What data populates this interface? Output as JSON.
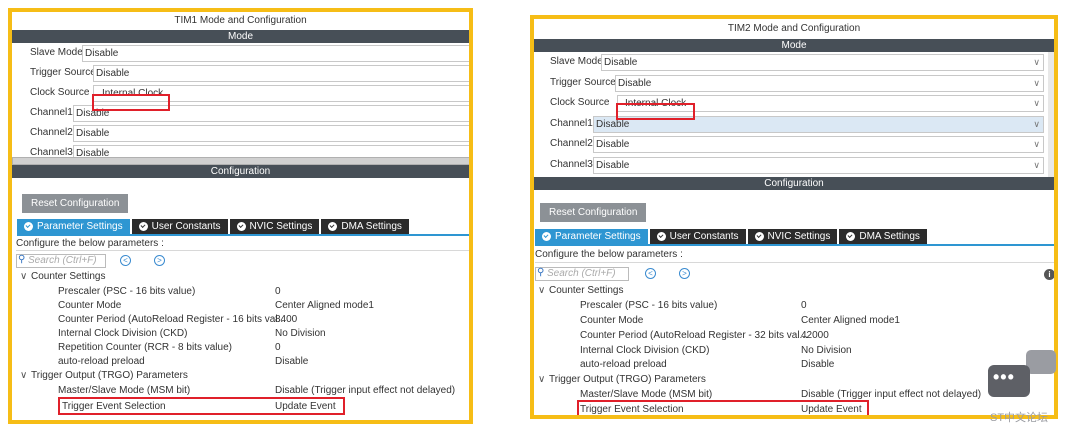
{
  "panels": [
    {
      "title": "TIM1 Mode and Configuration",
      "mode_header": "Mode",
      "mode_rows": [
        {
          "label": "Slave Mode",
          "value": "Disable"
        },
        {
          "label": "Trigger Source",
          "value": "Disable"
        },
        {
          "label": "Clock Source",
          "value": "Internal Clock"
        },
        {
          "label": "Channel1",
          "value": "Disable"
        },
        {
          "label": "Channel2",
          "value": "Disable"
        },
        {
          "label": "Channel3",
          "value": "Disable"
        }
      ],
      "config_header": "Configuration",
      "reset_label": "Reset Configuration",
      "tabs": [
        "Parameter Settings",
        "User Constants",
        "NVIC Settings",
        "DMA Settings"
      ],
      "configure_text": "Configure the below parameters :",
      "search_placeholder": "Search (Ctrl+F)",
      "groups": [
        {
          "name": "Counter Settings",
          "params": [
            {
              "name": "Prescaler (PSC - 16 bits value)",
              "value": "0"
            },
            {
              "name": "Counter Mode",
              "value": "Center Aligned mode1"
            },
            {
              "name": "Counter Period (AutoReload Register - 16 bits val...",
              "value": "8400"
            },
            {
              "name": "Internal Clock Division (CKD)",
              "value": "No Division"
            },
            {
              "name": "Repetition Counter (RCR - 8 bits value)",
              "value": "0"
            },
            {
              "name": "auto-reload preload",
              "value": "Disable"
            }
          ]
        },
        {
          "name": "Trigger Output (TRGO) Parameters",
          "params": [
            {
              "name": "Master/Slave Mode (MSM bit)",
              "value": "Disable (Trigger input effect not delayed)"
            },
            {
              "name": "Trigger Event Selection",
              "value": "Update Event"
            }
          ]
        }
      ]
    },
    {
      "title": "TIM2 Mode and Configuration",
      "mode_header": "Mode",
      "mode_rows": [
        {
          "label": "Slave Mode",
          "value": "Disable"
        },
        {
          "label": "Trigger Source",
          "value": "Disable"
        },
        {
          "label": "Clock Source",
          "value": "Internal Clock"
        },
        {
          "label": "Channel1",
          "value": "Disable"
        },
        {
          "label": "Channel2",
          "value": "Disable"
        },
        {
          "label": "Channel3",
          "value": "Disable"
        }
      ],
      "config_header": "Configuration",
      "reset_label": "Reset Configuration",
      "tabs": [
        "Parameter Settings",
        "User Constants",
        "NVIC Settings",
        "DMA Settings"
      ],
      "configure_text": "Configure the below parameters :",
      "search_placeholder": "Search (Ctrl+F)",
      "groups": [
        {
          "name": "Counter Settings",
          "params": [
            {
              "name": "Prescaler (PSC - 16 bits value)",
              "value": "0"
            },
            {
              "name": "Counter Mode",
              "value": "Center Aligned mode1"
            },
            {
              "name": "Counter Period (AutoReload Register - 32 bits val...",
              "value": "42000"
            },
            {
              "name": "Internal Clock Division (CKD)",
              "value": "No Division"
            },
            {
              "name": "auto-reload preload",
              "value": "Disable"
            }
          ]
        },
        {
          "name": "Trigger Output (TRGO) Parameters",
          "params": [
            {
              "name": "Master/Slave Mode (MSM bit)",
              "value": "Disable (Trigger input effect not delayed)"
            },
            {
              "name": "Trigger Event Selection",
              "value": "Update Event"
            }
          ]
        }
      ]
    }
  ],
  "watermark": {
    "text": "ST中文论坛"
  },
  "colors": {
    "highlight_border": "#e0202a",
    "panel_border": "#f6bd16",
    "tab_active": "#2e96d2",
    "header_bar": "#474f57"
  }
}
